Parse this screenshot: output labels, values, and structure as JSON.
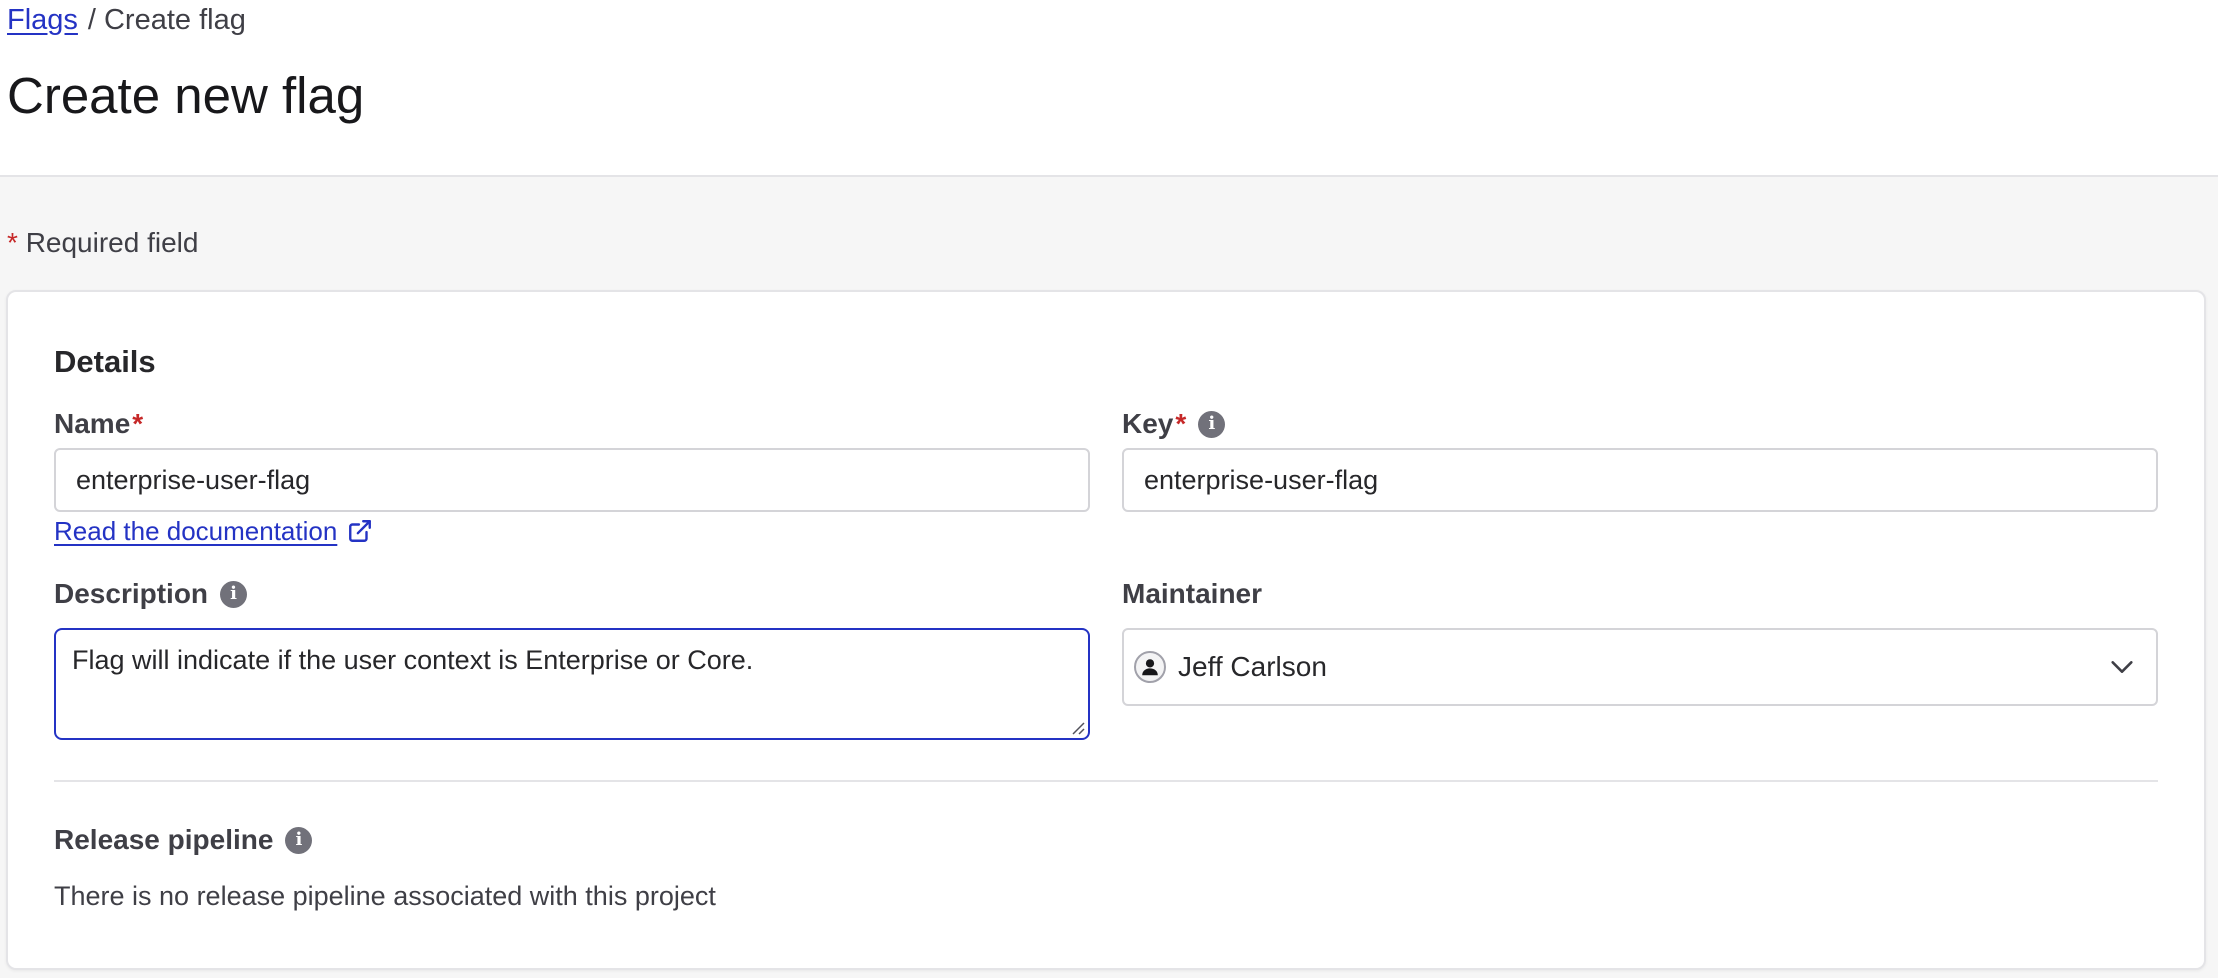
{
  "breadcrumb": {
    "parent": "Flags",
    "separator": "/",
    "current": "Create flag"
  },
  "page_title": "Create new flag",
  "required_note": {
    "asterisk": "*",
    "text": "Required field"
  },
  "details": {
    "title": "Details",
    "name": {
      "label": "Name",
      "required_mark": "*",
      "value": "enterprise-user-flag"
    },
    "key": {
      "label": "Key",
      "required_mark": "*",
      "value": "enterprise-user-flag",
      "info_icon": "info-icon"
    },
    "doc_link": {
      "label": "Read the documentation",
      "icon": "external-link-icon"
    },
    "description": {
      "label": "Description",
      "value": "Flag will indicate if the user context is Enterprise or Core.",
      "info_icon": "info-icon"
    },
    "maintainer": {
      "label": "Maintainer",
      "value": "Jeff Carlson",
      "icon": "user-avatar-icon",
      "dropdown_icon": "chevron-down-icon"
    }
  },
  "release_pipeline": {
    "label": "Release pipeline",
    "text": "There is no release pipeline associated with this project",
    "info_icon": "info-icon"
  },
  "colors": {
    "link": "#2433c4",
    "required": "#c62828",
    "focus_border": "#2433c4",
    "page_background": "#f6f6f6"
  }
}
